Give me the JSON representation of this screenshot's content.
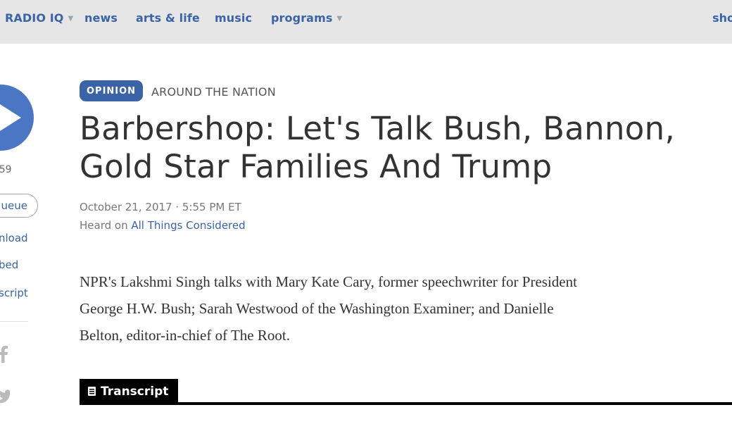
{
  "nav": {
    "station": "RADIO IQ",
    "items": [
      "news",
      "arts & life",
      "music",
      "programs"
    ],
    "right_partial": "sho"
  },
  "player": {
    "duration": ":59",
    "queue_label": "ueue",
    "links": [
      "nload",
      "bed",
      "script"
    ]
  },
  "article": {
    "badge": "OPINION",
    "section": "AROUND THE NATION",
    "headline_line1": "Barbershop: Let's Talk Bush, Bannon,",
    "headline_line2": "Gold Star Families And Trump",
    "dateline": "October 21, 2017 · 5:55 PM ET",
    "heard_on_prefix": "Heard on ",
    "heard_on_program": "All Things Considered",
    "summary_lines": [
      "NPR's Lakshmi Singh talks with Mary Kate Cary, former speechwriter for President",
      "George H.W. Bush; Sarah Westwood of the Washington Examiner; and Danielle",
      "Belton, editor-in-chief of The Root."
    ],
    "transcript_label": "Transcript"
  },
  "colors": {
    "nav_bg": "#e6e6e6",
    "link_blue": "#3a63a8",
    "play_blue": "#4b76c4",
    "headline": "#333333"
  },
  "icons": [
    "chevron-down-icon",
    "play-icon",
    "facebook-icon",
    "twitter-icon",
    "transcript-icon"
  ]
}
